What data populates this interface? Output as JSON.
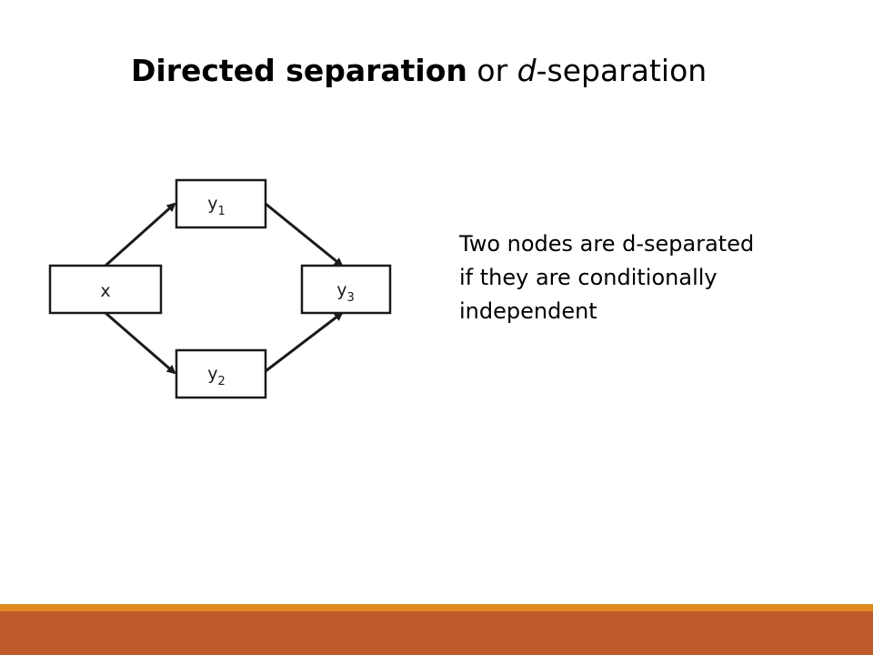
{
  "slide": {
    "title_bold": "Directed separation",
    "title_connector": "or",
    "title_italic": "d",
    "title_suffix": "-separation"
  },
  "diagram": {
    "nodes": [
      {
        "id": "x",
        "label": "x",
        "subscript": ""
      },
      {
        "id": "y1",
        "label": "y",
        "subscript": "1"
      },
      {
        "id": "y2",
        "label": "y",
        "subscript": "2"
      },
      {
        "id": "y3",
        "label": "y",
        "subscript": "3"
      }
    ],
    "edges": [
      {
        "from": "x",
        "to": "y1"
      },
      {
        "from": "x",
        "to": "y2"
      },
      {
        "from": "y1",
        "to": "y3"
      },
      {
        "from": "y2",
        "to": "y3"
      }
    ]
  },
  "body": {
    "lines": [
      "Two nodes are d-separated",
      "if they are conditionally",
      "independent"
    ]
  },
  "colors": {
    "footer_thin": "#e08a1e",
    "footer_bar": "#bf5a2c",
    "node_stroke": "#1a1a1a"
  }
}
